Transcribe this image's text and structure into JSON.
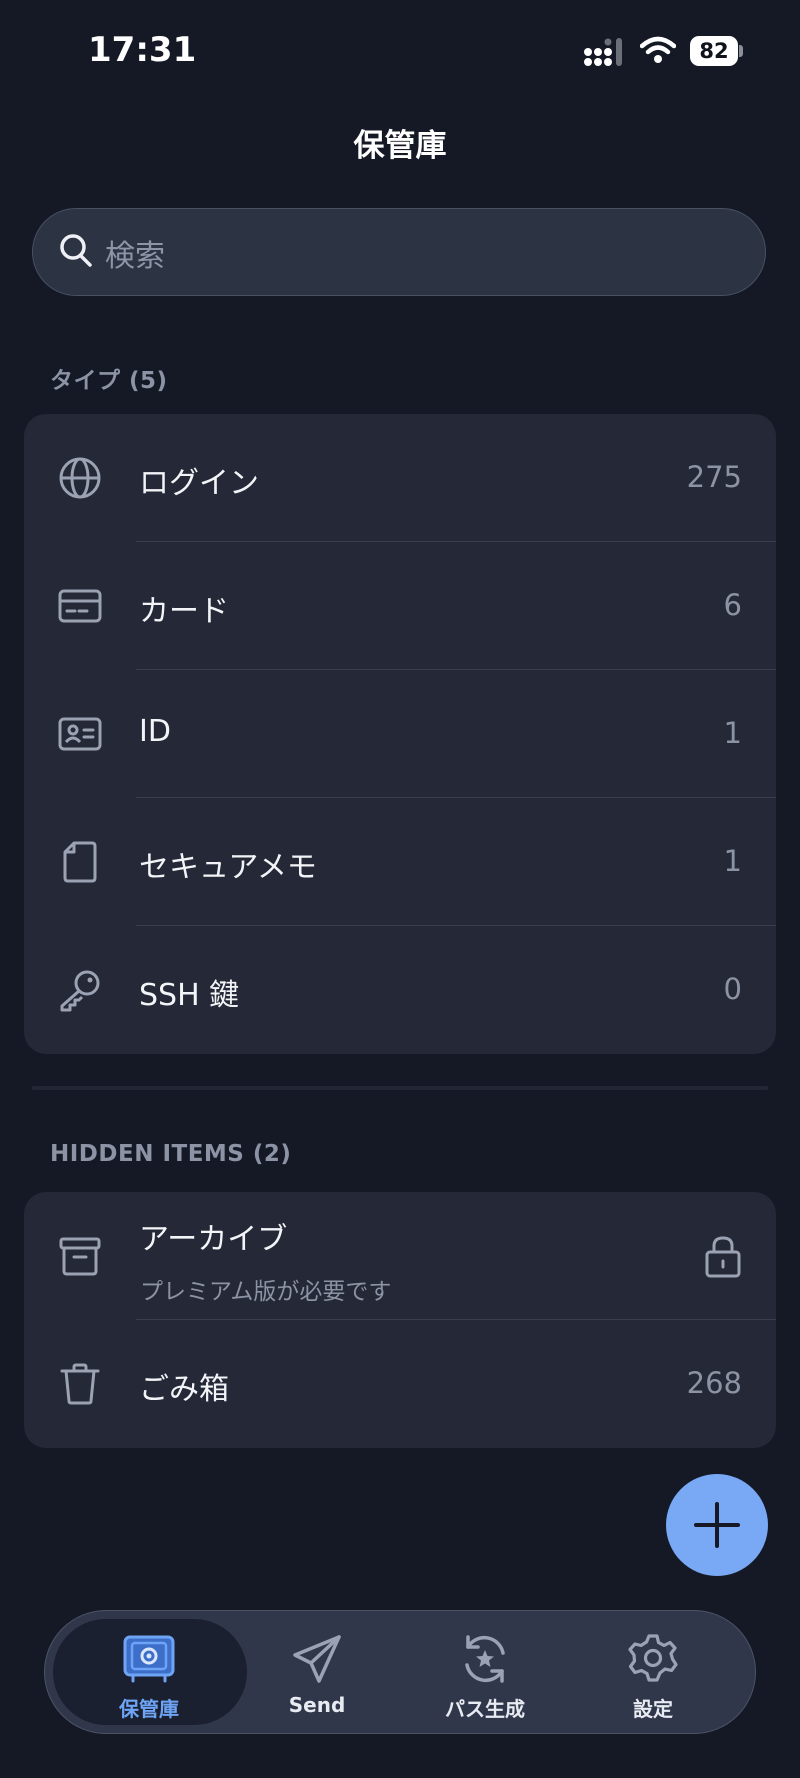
{
  "status_bar": {
    "time": "17:31",
    "battery": "82"
  },
  "nav": {
    "title": "保管庫"
  },
  "search": {
    "placeholder": "検索"
  },
  "types_section": {
    "header": "タイプ (5)",
    "items": [
      {
        "label": "ログイン",
        "count": "275",
        "icon": "globe-icon"
      },
      {
        "label": "カード",
        "count": "6",
        "icon": "credit-card-icon"
      },
      {
        "label": "ID",
        "count": "1",
        "icon": "id-card-icon"
      },
      {
        "label": "セキュアメモ",
        "count": "1",
        "icon": "note-icon"
      },
      {
        "label": "SSH 鍵",
        "count": "0",
        "icon": "key-icon"
      }
    ]
  },
  "hidden_section": {
    "header": "HIDDEN ITEMS (2)",
    "items": [
      {
        "label": "アーカイブ",
        "subtitle": "プレミアム版が必要です",
        "icon": "archive-icon",
        "trailing_icon": "lock-icon"
      },
      {
        "label": "ごみ箱",
        "count": "268",
        "icon": "trash-icon"
      }
    ]
  },
  "fab": {
    "icon": "plus-icon"
  },
  "tab_bar": {
    "tabs": [
      {
        "label": "保管庫",
        "icon": "vault-icon",
        "active": true
      },
      {
        "label": "Send",
        "icon": "send-icon",
        "active": false
      },
      {
        "label": "パス生成",
        "icon": "generator-icon",
        "active": false
      },
      {
        "label": "設定",
        "icon": "settings-gear-icon",
        "active": false
      }
    ]
  },
  "colors": {
    "background": "#141925",
    "card": "#252836",
    "accent": "#79a8f5",
    "active_tab_label": "#6ea4f5"
  }
}
